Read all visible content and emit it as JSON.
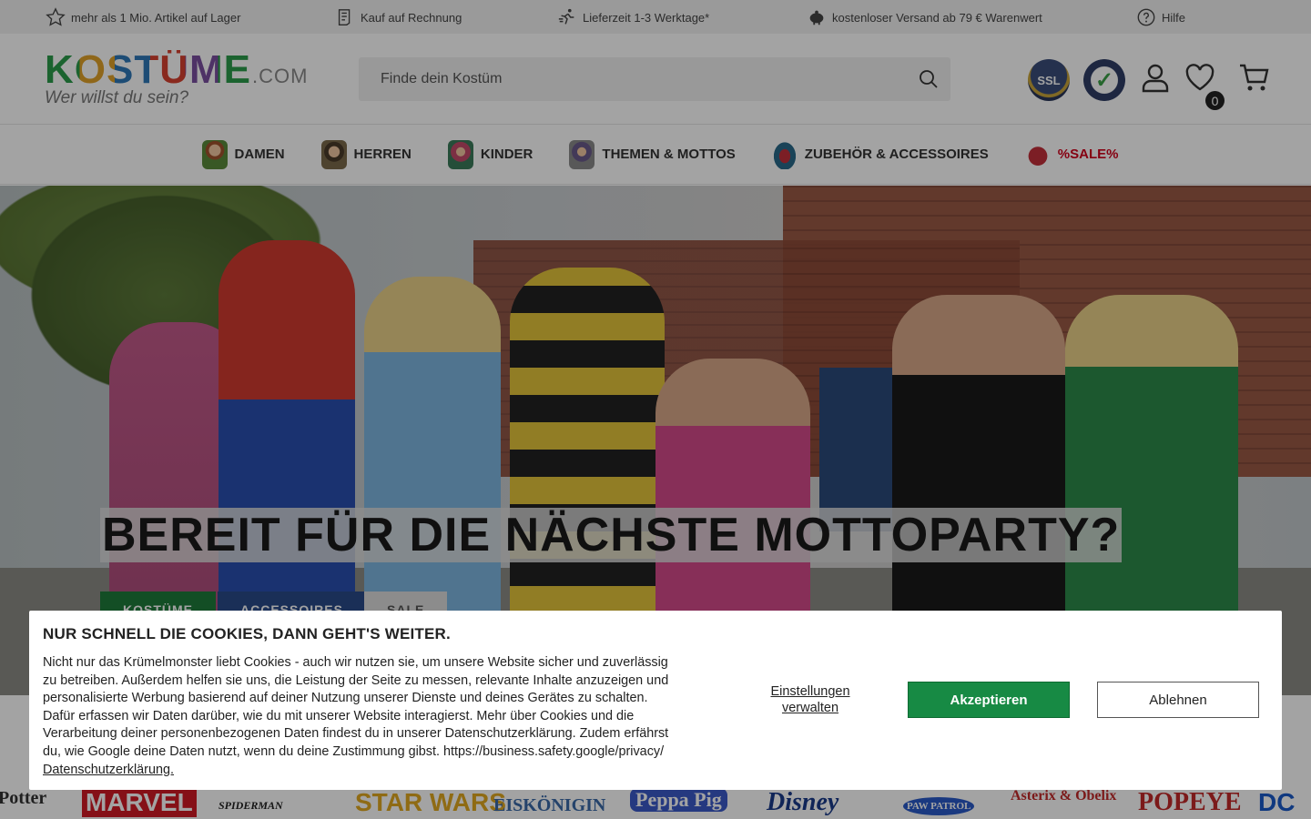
{
  "topbar": {
    "usps": [
      {
        "label": "mehr als 1 Mio. Artikel auf Lager",
        "icon": "star-icon"
      },
      {
        "label": "Kauf auf Rechnung",
        "icon": "invoice-icon"
      },
      {
        "label": "Lieferzeit 1-3 Werktage*",
        "icon": "running-icon"
      },
      {
        "label": "kostenloser Versand ab 79 € Warenwert",
        "icon": "piggybank-icon"
      },
      {
        "label": "Hilfe",
        "icon": "help-icon"
      }
    ]
  },
  "header": {
    "logo_word": "KOSTÜME",
    "logo_suffix": ".COM",
    "logo_tagline": "Wer willst du sein?",
    "search_placeholder": "Finde dein Kostüm",
    "ssl_badge": "SSL",
    "wishlist_count": "0"
  },
  "nav": {
    "items": [
      {
        "label": "DAMEN"
      },
      {
        "label": "HERREN"
      },
      {
        "label": "KINDER"
      },
      {
        "label": "THEMEN & MOTTOS"
      },
      {
        "label": "ZUBEHÖR & ACCESSOIRES"
      },
      {
        "label": "%SALE%"
      }
    ]
  },
  "hero": {
    "headline": "BEREIT FÜR DIE NÄCHSTE MOTTOPARTY?",
    "buttons": [
      "KOSTÜME",
      "ACCESSOIRES",
      "SALE"
    ]
  },
  "brands": [
    "Potter",
    "MARVEL",
    "SPIDERMAN",
    "STAR WARS",
    "EISKÖNIGIN",
    "Peppa Pig",
    "Disney",
    "PAW PATROL",
    "Asterix & Obelix",
    "POPEYE",
    "DC"
  ],
  "cookie": {
    "title": "NUR SCHNELL DIE COOKIES, DANN GEHT'S WEITER.",
    "body": "Nicht nur das Krümelmonster liebt Cookies - auch wir nutzen sie, um unsere Website sicher und zuverlässig zu betreiben. Außerdem helfen sie uns, die Leistung der Seite zu messen, relevante Inhalte anzuzeigen und personalisierte Werbung basierend auf deiner Nutzung unserer Dienste und deines Gerätes zu schalten. Dafür erfassen wir Daten darüber, wie du mit unserer Website interagierst. Mehr über Cookies und die Verarbeitung deiner personenbezogenen Daten findest du in unserer Datenschutzerklärung. Zudem erfährst du, wie Google deine Daten nutzt, wenn du deine Zustimmung gibst. https://business.safety.google/privacy/",
    "privacy_link": "Datenschutzerklärung.",
    "settings_label": "Einstellungen verwalten",
    "accept_label": "Akzeptieren",
    "decline_label": "Ablehnen"
  },
  "colors": {
    "accept_green": "#178a44",
    "sale_red": "#d0021b"
  }
}
